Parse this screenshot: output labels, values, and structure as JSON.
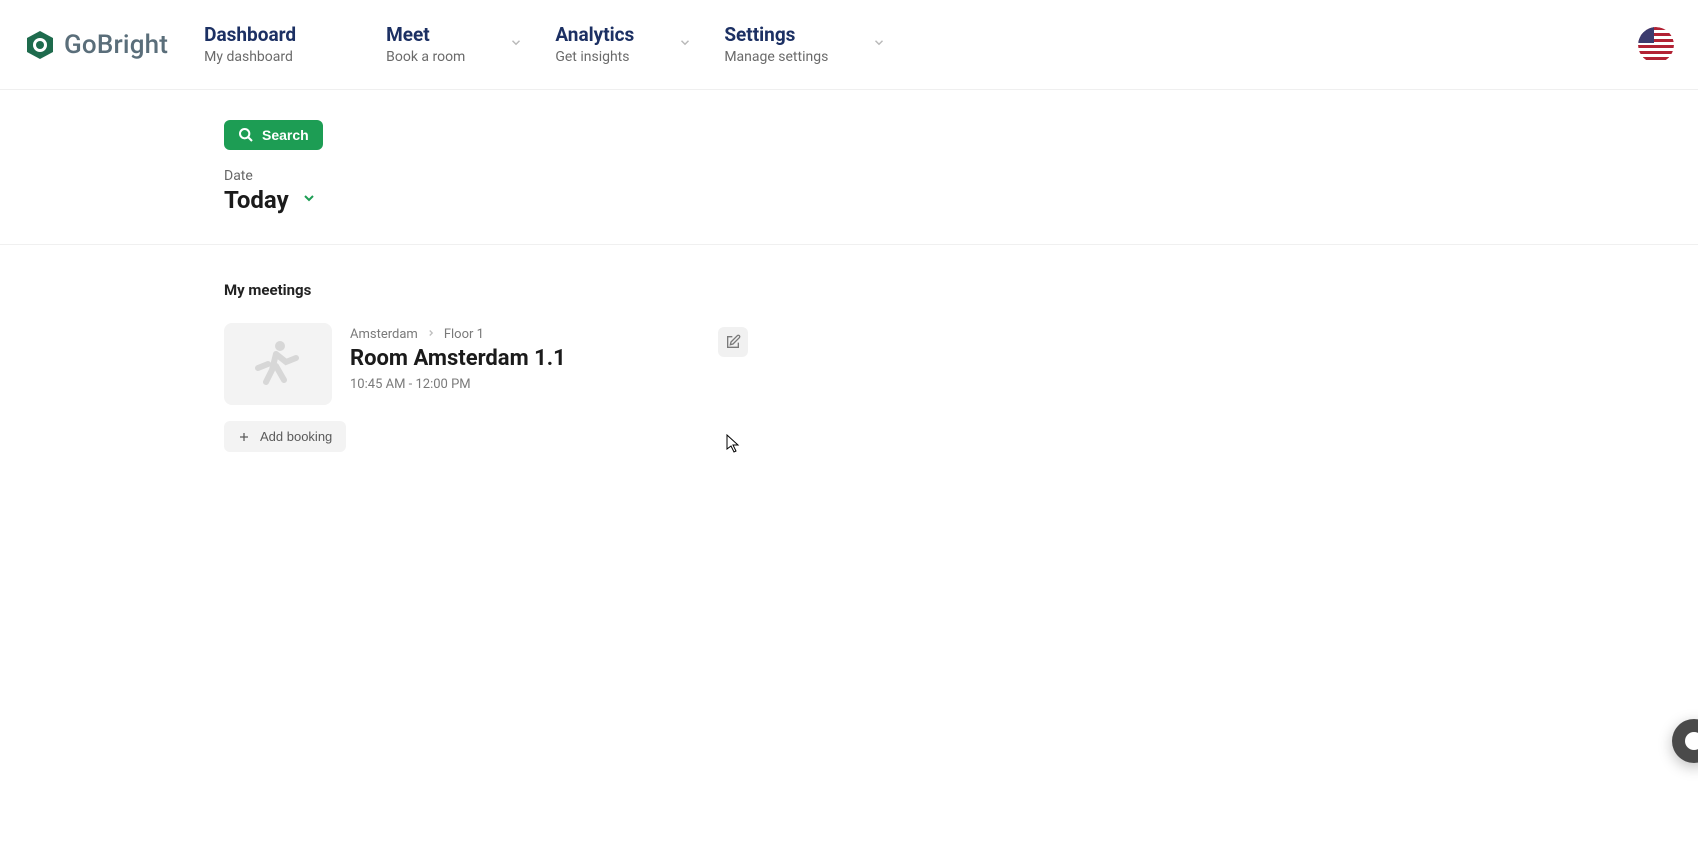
{
  "brand": {
    "name": "GoBright"
  },
  "nav": {
    "items": [
      {
        "title": "Dashboard",
        "subtitle": "My dashboard",
        "dropdown": false
      },
      {
        "title": "Meet",
        "subtitle": "Book a room",
        "dropdown": true
      },
      {
        "title": "Analytics",
        "subtitle": "Get insights",
        "dropdown": true
      },
      {
        "title": "Settings",
        "subtitle": "Manage settings",
        "dropdown": true
      }
    ]
  },
  "filters": {
    "search_label": "Search",
    "date_label": "Date",
    "date_value": "Today"
  },
  "meetings": {
    "section_title": "My meetings",
    "items": [
      {
        "breadcrumb": [
          "Amsterdam",
          "Floor 1"
        ],
        "room": "Room Amsterdam 1.1",
        "time_range": "10:45 AM - 12:00 PM"
      }
    ],
    "add_label": "Add booking"
  },
  "locale": {
    "flag": "us"
  }
}
